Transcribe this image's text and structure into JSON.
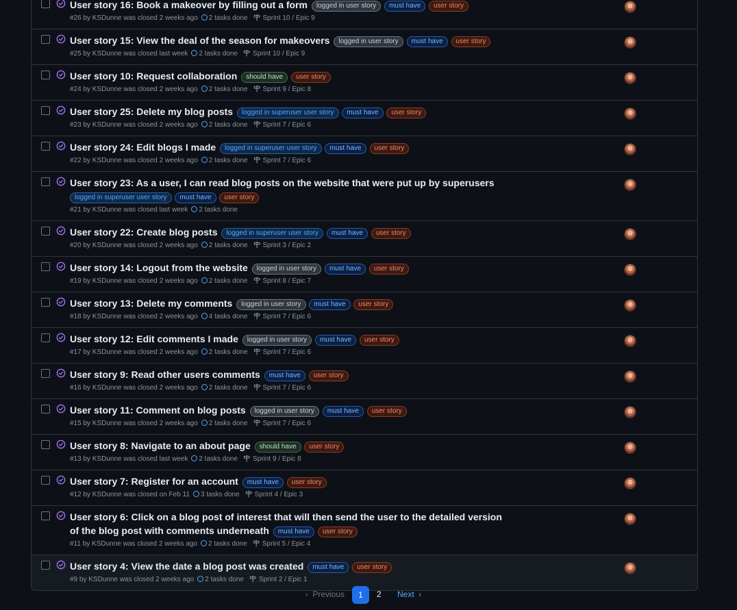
{
  "issues": [
    {
      "title": "User story 16: Book a makeover by filling out a form",
      "labels": [
        {
          "text": "logged in user story",
          "kind": "logged"
        },
        {
          "text": "must have",
          "kind": "must"
        },
        {
          "text": "user story",
          "kind": "user"
        }
      ],
      "meta": "#26 by KSDunne was closed 2 weeks ago",
      "tasks": "2 tasks done",
      "milestone": "Sprint 10 / Epic 9",
      "multiline": false,
      "title_height": 18
    },
    {
      "title": "User story 15: View the deal of the season for makeovers",
      "labels": [
        {
          "text": "logged in user story",
          "kind": "logged"
        },
        {
          "text": "must have",
          "kind": "must"
        },
        {
          "text": "user story",
          "kind": "user"
        }
      ],
      "meta": "#25 by KSDunne was closed last week",
      "tasks": "2 tasks done",
      "milestone": "Sprint 10 / Epic 9"
    },
    {
      "title": "User story 10: Request collaboration",
      "labels": [
        {
          "text": "should have",
          "kind": "should"
        },
        {
          "text": "user story",
          "kind": "user"
        }
      ],
      "meta": "#24 by KSDunne was closed 2 weeks ago",
      "tasks": "2 tasks done",
      "milestone": "Sprint 9 / Epic 8"
    },
    {
      "title": "User story 25: Delete my blog posts",
      "labels": [
        {
          "text": "logged in superuser user story",
          "kind": "super"
        },
        {
          "text": "must have",
          "kind": "must"
        },
        {
          "text": "user story",
          "kind": "user"
        }
      ],
      "meta": "#23 by KSDunne was closed 2 weeks ago",
      "tasks": "2 tasks done",
      "milestone": "Sprint 7 / Epic 6"
    },
    {
      "title": "User story 24: Edit blogs I made",
      "labels": [
        {
          "text": "logged in superuser user story",
          "kind": "super"
        },
        {
          "text": "must have",
          "kind": "must"
        },
        {
          "text": "user story",
          "kind": "user"
        }
      ],
      "meta": "#22 by KSDunne was closed 2 weeks ago",
      "tasks": "2 tasks done",
      "milestone": "Sprint 7 / Epic 6"
    },
    {
      "title": "User story 23: As a user, I can read blog posts on the website that were put up by superusers",
      "labels": [
        {
          "text": "logged in superuser user story",
          "kind": "super"
        },
        {
          "text": "must have",
          "kind": "must"
        },
        {
          "text": "user story",
          "kind": "user"
        }
      ],
      "meta": "#21 by KSDunne was closed last week",
      "tasks": "2 tasks done",
      "milestone": ""
    },
    {
      "title": "User story 22: Create blog posts",
      "labels": [
        {
          "text": "logged in superuser user story",
          "kind": "super"
        },
        {
          "text": "must have",
          "kind": "must"
        },
        {
          "text": "user story",
          "kind": "user"
        }
      ],
      "meta": "#20 by KSDunne was closed 2 weeks ago",
      "tasks": "2 tasks done",
      "milestone": "Sprint 3 / Epic 2"
    },
    {
      "title": "User story 14: Logout from the website",
      "labels": [
        {
          "text": "logged in user story",
          "kind": "logged"
        },
        {
          "text": "must have",
          "kind": "must"
        },
        {
          "text": "user story",
          "kind": "user"
        }
      ],
      "meta": "#19 by KSDunne was closed 2 weeks ago",
      "tasks": "2 tasks done",
      "milestone": "Sprint 8 / Epic 7"
    },
    {
      "title": "User story 13: Delete my comments",
      "labels": [
        {
          "text": "logged in user story",
          "kind": "logged"
        },
        {
          "text": "must have",
          "kind": "must"
        },
        {
          "text": "user story",
          "kind": "user"
        }
      ],
      "meta": "#18 by KSDunne was closed 2 weeks ago",
      "tasks": "4 tasks done",
      "milestone": "Sprint 7 / Epic 6"
    },
    {
      "title": "User story 12: Edit comments I made",
      "labels": [
        {
          "text": "logged in user story",
          "kind": "logged"
        },
        {
          "text": "must have",
          "kind": "must"
        },
        {
          "text": "user story",
          "kind": "user"
        }
      ],
      "meta": "#17 by KSDunne was closed 2 weeks ago",
      "tasks": "2 tasks done",
      "milestone": "Sprint 7 / Epic 6"
    },
    {
      "title": "User story 9: Read other users comments",
      "labels": [
        {
          "text": "must have",
          "kind": "must"
        },
        {
          "text": "user story",
          "kind": "user"
        }
      ],
      "meta": "#16 by KSDunne was closed 2 weeks ago",
      "tasks": "2 tasks done",
      "milestone": "Sprint 7 / Epic 6"
    },
    {
      "title": "User story 11: Comment on blog posts",
      "labels": [
        {
          "text": "logged in user story",
          "kind": "logged"
        },
        {
          "text": "must have",
          "kind": "must"
        },
        {
          "text": "user story",
          "kind": "user"
        }
      ],
      "meta": "#15 by KSDunne was closed 2 weeks ago",
      "tasks": "2 tasks done",
      "milestone": "Sprint 7 / Epic 6"
    },
    {
      "title": "User story 8: Navigate to an about page",
      "labels": [
        {
          "text": "should have",
          "kind": "should"
        },
        {
          "text": "user story",
          "kind": "user"
        }
      ],
      "meta": "#13 by KSDunne was closed last week",
      "tasks": "2 tasks done",
      "milestone": "Sprint 9 / Epic 8"
    },
    {
      "title": "User story 7: Register for an account",
      "labels": [
        {
          "text": "must have",
          "kind": "must"
        },
        {
          "text": "user story",
          "kind": "user"
        }
      ],
      "meta": "#12 by KSDunne was closed on Feb 11",
      "tasks": "3 tasks done",
      "milestone": "Sprint 4 / Epic 3"
    },
    {
      "title": "User story 6: Click on a blog post of interest that will then send the user to the detailed version of the blog post with comments underneath",
      "labels": [
        {
          "text": "must have",
          "kind": "must"
        },
        {
          "text": "user story",
          "kind": "user"
        }
      ],
      "meta": "#11 by KSDunne was closed 2 weeks ago",
      "tasks": "2 tasks done",
      "milestone": "Sprint 5 / Epic 4"
    },
    {
      "title": "User story 4: View the date a blog post was created",
      "labels": [
        {
          "text": "must have",
          "kind": "must"
        },
        {
          "text": "user story",
          "kind": "user"
        }
      ],
      "meta": "#9 by KSDunne was closed 2 weeks ago",
      "tasks": "2 tasks done",
      "milestone": "Sprint 2 / Epic 1",
      "hover": true
    }
  ],
  "pagination": {
    "previous": "Previous",
    "page1": "1",
    "page2": "2",
    "next": "Next"
  },
  "colors": {
    "accent": "#1f6feb",
    "closed_icon": "#a371f7",
    "bg": "#0d1117"
  }
}
